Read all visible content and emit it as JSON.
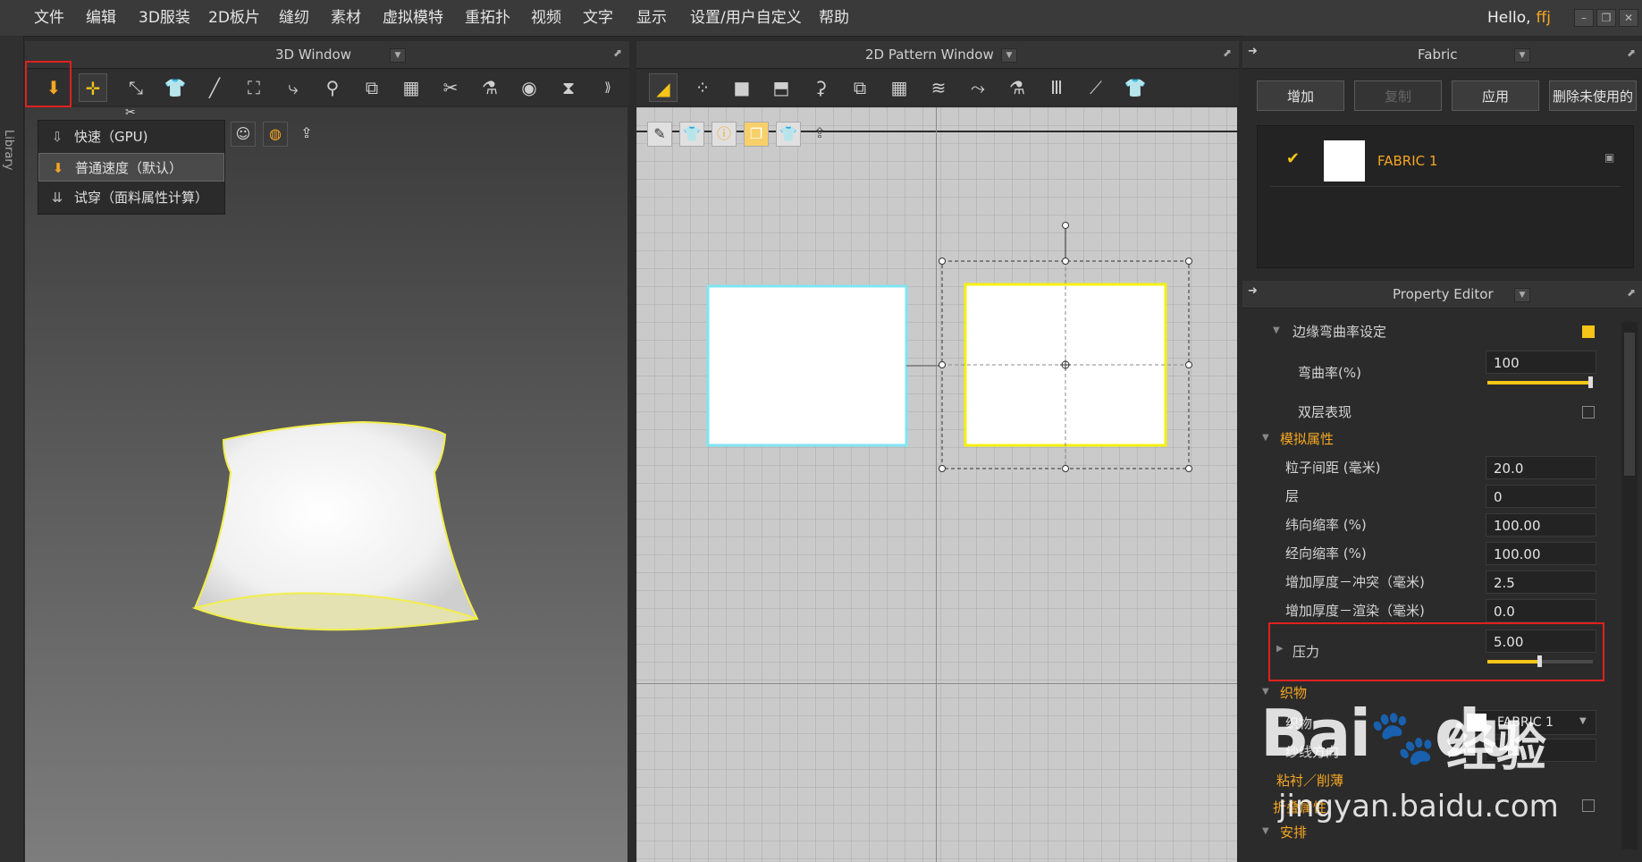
{
  "menu": {
    "items": [
      "文件",
      "编辑",
      "3D服装",
      "2D板片",
      "缝纫",
      "素材",
      "虚拟模特",
      "重拓扑",
      "视频",
      "文字",
      "显示",
      "设置/用户自定义",
      "帮助"
    ],
    "hello": "Hello,",
    "user": "ffj"
  },
  "library": {
    "label": "Library"
  },
  "window3d": {
    "title": "3D Window"
  },
  "window2d": {
    "title": "2D Pattern Window"
  },
  "simulate_menu": {
    "items": [
      {
        "label": "快速（GPU)",
        "icon": "arrow-down-outline-icon"
      },
      {
        "label": "普通速度（默认）",
        "icon": "arrow-down-orange-icon"
      },
      {
        "label": "试穿（面料属性计算）",
        "icon": "arrow-down-double-icon"
      }
    ]
  },
  "fabric": {
    "title": "Fabric",
    "buttons": {
      "add": "增加",
      "copy": "复制",
      "apply": "应用",
      "delete_unused": "删除未使用的"
    },
    "items": [
      {
        "name": "FABRIC 1",
        "checked": true
      }
    ]
  },
  "property_editor": {
    "title": "Property Editor",
    "edge_curve": {
      "label": "边缘弯曲率设定",
      "checked": true
    },
    "curvature": {
      "label": "弯曲率(%)",
      "value": "100",
      "slider_fraction": 0.98
    },
    "double_layer": {
      "label": "双层表现",
      "checked": false
    },
    "sim_section": "模拟属性",
    "particle_distance": {
      "label": "粒子间距 (毫米)",
      "value": "20.0"
    },
    "layer": {
      "label": "层",
      "value": "0"
    },
    "weft_shrink": {
      "label": "纬向缩率 (%)",
      "value": "100.00"
    },
    "warp_shrink": {
      "label": "经向缩率 (%)",
      "value": "100.00"
    },
    "thickness_collision": {
      "label": "增加厚度－冲突（毫米)",
      "value": "2.5"
    },
    "thickness_render": {
      "label": "增加厚度－渲染（毫米)",
      "value": "0.0"
    },
    "pressure": {
      "label": "压力",
      "value": "5.00",
      "slider_fraction": 0.5
    },
    "fabric_section": "织物",
    "fabric_field": {
      "label": "织物",
      "value": "FABRIC 1"
    },
    "grain": {
      "label": "纱线方向"
    },
    "sew": {
      "label": "粘衬／削薄"
    },
    "fold": {
      "label": "折叠属性"
    },
    "arrange": {
      "label": "安排"
    }
  },
  "watermark": {
    "brand_cn": "经验",
    "url": "jingyan.baidu.com"
  },
  "colors": {
    "accent": "#f5a623",
    "highlight_yellow": "#f5f010",
    "selected_cyan": "#7fe6f2",
    "red_box": "#e02020"
  }
}
